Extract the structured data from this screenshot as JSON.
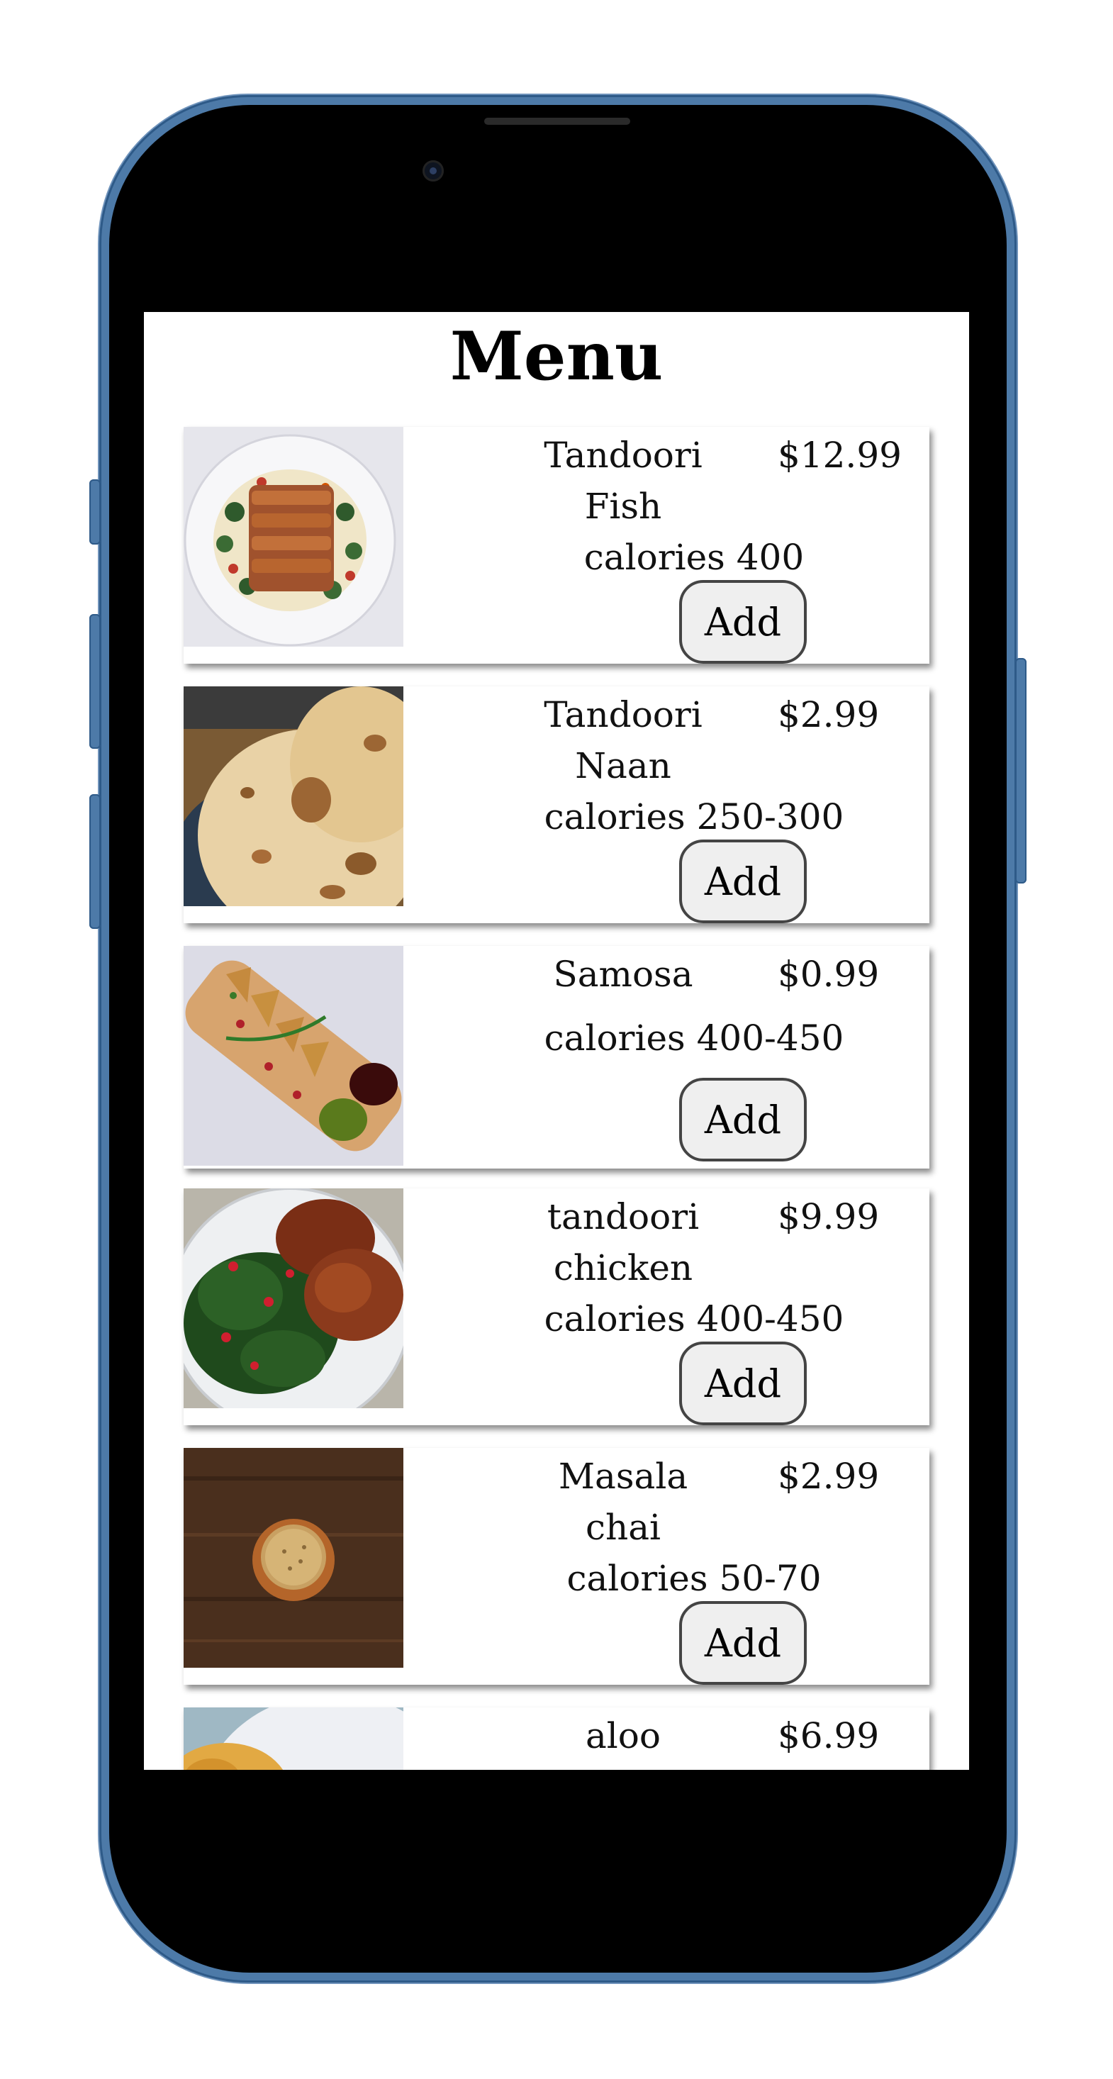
{
  "page": {
    "title": "Menu"
  },
  "menu": {
    "add_label": "Add",
    "items": [
      {
        "name": "Tandoori Fish",
        "price": "$12.99",
        "calories": "calories 400",
        "image_icon": "grilled-fish-plate"
      },
      {
        "name": "Tandoori Naan",
        "price": "$2.99",
        "calories": "calories 250-300",
        "image_icon": "naan-bread"
      },
      {
        "name": "Samosa",
        "price": "$0.99",
        "calories": "calories 400-450",
        "image_icon": "samosa-platter"
      },
      {
        "name": "tandoori chicken",
        "price": "$9.99",
        "calories": "calories 400-450",
        "image_icon": "chicken-with-greens"
      },
      {
        "name": "Masala chai",
        "price": "$2.99",
        "calories": "calories 50-70",
        "image_icon": "chai-cup-on-wood"
      },
      {
        "name": "aloo",
        "price": "$6.99",
        "calories": "",
        "image_icon": "aloo-puri-plate"
      }
    ]
  },
  "colors": {
    "phone_frame": "#4d7aa8",
    "button_bg": "#efefef",
    "button_border": "#444444"
  }
}
